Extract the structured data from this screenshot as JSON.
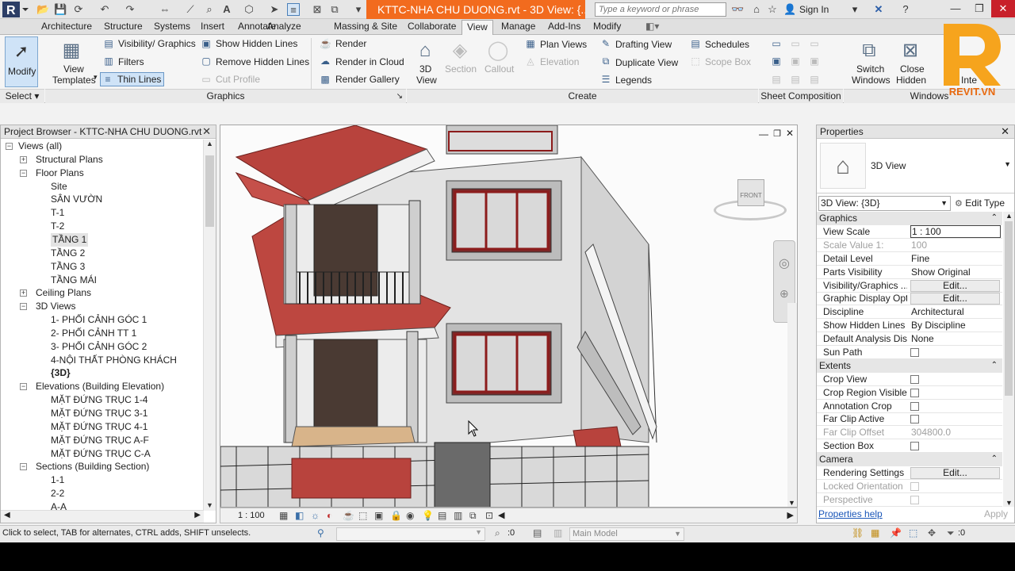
{
  "titlebar": {
    "document_title": "KTTC-NHA CHU DUONG.rvt - 3D View: {...",
    "search_placeholder": "Type a keyword or phrase",
    "sign_in": "Sign In",
    "close_glyph": "✕",
    "min_glyph": "—",
    "max_glyph": "❐"
  },
  "tabs": [
    "Architecture",
    "Structure",
    "Systems",
    "Insert",
    "Annotate",
    "Analyze",
    "Massing & Site",
    "Collaborate",
    "View",
    "Manage",
    "Add-Ins",
    "Modify"
  ],
  "active_tab": "View",
  "ribbon": {
    "modify": "Modify",
    "select": "Select",
    "view_templates_1": "View",
    "view_templates_2": "Templates",
    "visibility_graphics": "Visibility/ Graphics",
    "filters": "Filters",
    "thin_lines": "Thin  Lines",
    "show_hidden_lines": "Show  Hidden Lines",
    "remove_hidden_lines": "Remove  Hidden Lines",
    "cut_profile": "Cut  Profile",
    "render": "Render",
    "render_in_cloud": "Render  in Cloud",
    "render_gallery": "Render  Gallery",
    "graphics_panel": "Graphics",
    "view_3d_1": "3D",
    "view_3d_2": "View",
    "section": "Section",
    "callout": "Callout",
    "plan_views": "Plan  Views",
    "elevation": "Elevation",
    "drafting_view": "Drafting  View",
    "duplicate_view": "Duplicate  View",
    "legends": "Legends",
    "schedules": "Schedules",
    "scope_box": "Scope  Box",
    "create_panel": "Create",
    "sheet_composition": "Sheet Composition",
    "switch_windows_1": "Switch",
    "switch_windows_2": "Windows",
    "close_hidden_1": "Close",
    "close_hidden_2": "Hidden",
    "interface": "Inte",
    "windows_panel": "Windows",
    "brand_text": "REVIT.VN"
  },
  "project_browser": {
    "title": "Project Browser - KTTC-NHA CHU DUONG.rvt",
    "items": [
      {
        "label": "Views (all)",
        "level": 0,
        "exp": "−"
      },
      {
        "label": "Structural Plans",
        "level": 1,
        "exp": "+"
      },
      {
        "label": "Floor Plans",
        "level": 1,
        "exp": "−"
      },
      {
        "label": "Site",
        "level": 2
      },
      {
        "label": "SÂN VƯỜN",
        "level": 2
      },
      {
        "label": "T-1",
        "level": 2
      },
      {
        "label": "T-2",
        "level": 2
      },
      {
        "label": "TẦNG 1",
        "level": 2,
        "selected": true
      },
      {
        "label": "TẦNG 2",
        "level": 2
      },
      {
        "label": "TẦNG 3",
        "level": 2
      },
      {
        "label": "TẦNG MÁI",
        "level": 2
      },
      {
        "label": "Ceiling Plans",
        "level": 1,
        "exp": "+"
      },
      {
        "label": "3D Views",
        "level": 1,
        "exp": "−"
      },
      {
        "label": "1- PHỐI CẢNH GÓC 1",
        "level": 2
      },
      {
        "label": "2- PHỐI CẢNH TT 1",
        "level": 2
      },
      {
        "label": "3- PHỐI CẢNH GÓC 2",
        "level": 2
      },
      {
        "label": "4-NỘI THẤT PHÒNG KHÁCH",
        "level": 2
      },
      {
        "label": "{3D}",
        "level": 2,
        "bold": true
      },
      {
        "label": "Elevations (Building Elevation)",
        "level": 1,
        "exp": "−"
      },
      {
        "label": "MẶT ĐỨNG TRỤC 1-4",
        "level": 2
      },
      {
        "label": "MẶT ĐỨNG TRỤC 3-1",
        "level": 2
      },
      {
        "label": "MẶT ĐỨNG TRỤC 4-1",
        "level": 2
      },
      {
        "label": "MẶT ĐỨNG TRỤC A-F",
        "level": 2
      },
      {
        "label": "MẶT ĐỨNG TRỤC C-A",
        "level": 2
      },
      {
        "label": "Sections (Building Section)",
        "level": 1,
        "exp": "−"
      },
      {
        "label": "1-1",
        "level": 2
      },
      {
        "label": "2-2",
        "level": 2
      },
      {
        "label": "A-A",
        "level": 2
      }
    ]
  },
  "viewport": {
    "scale": "1 : 100",
    "viewcube_label": "FRONT"
  },
  "properties": {
    "title": "Properties",
    "type_name": "3D View",
    "selector": "3D View: {3D}",
    "edit_type": "Edit Type",
    "rows": [
      {
        "kind": "group",
        "label": "Graphics"
      },
      {
        "kind": "input",
        "name": "View Scale",
        "value": "1 : 100"
      },
      {
        "kind": "text",
        "name": "Scale Value    1:",
        "value": "100",
        "disabled": true
      },
      {
        "kind": "text",
        "name": "Detail Level",
        "value": "Fine"
      },
      {
        "kind": "text",
        "name": "Parts Visibility",
        "value": "Show Original"
      },
      {
        "kind": "button",
        "name": "Visibility/Graphics ...",
        "value": "Edit..."
      },
      {
        "kind": "button",
        "name": "Graphic Display Opt...",
        "value": "Edit..."
      },
      {
        "kind": "text",
        "name": "Discipline",
        "value": "Architectural"
      },
      {
        "kind": "text",
        "name": "Show Hidden Lines",
        "value": "By Discipline"
      },
      {
        "kind": "text",
        "name": "Default Analysis Dis...",
        "value": "None"
      },
      {
        "kind": "check",
        "name": "Sun Path"
      },
      {
        "kind": "group",
        "label": "Extents"
      },
      {
        "kind": "check",
        "name": "Crop View"
      },
      {
        "kind": "check",
        "name": "Crop Region Visible"
      },
      {
        "kind": "check",
        "name": "Annotation Crop"
      },
      {
        "kind": "check",
        "name": "Far Clip Active"
      },
      {
        "kind": "text",
        "name": "Far Clip Offset",
        "value": "304800.0",
        "disabled": true
      },
      {
        "kind": "check",
        "name": "Section Box"
      },
      {
        "kind": "group",
        "label": "Camera"
      },
      {
        "kind": "button",
        "name": "Rendering Settings",
        "value": "Edit..."
      },
      {
        "kind": "check",
        "name": "Locked Orientation",
        "disabled": true
      },
      {
        "kind": "check",
        "name": "Perspective",
        "disabled": true
      }
    ],
    "help_link": "Properties help",
    "apply": "Apply"
  },
  "statusbar": {
    "message": "Click to select, TAB for alternates, CTRL adds, SHIFT unselects.",
    "worksets": ":0",
    "model": "Main Model",
    "filter_count": ":0"
  }
}
